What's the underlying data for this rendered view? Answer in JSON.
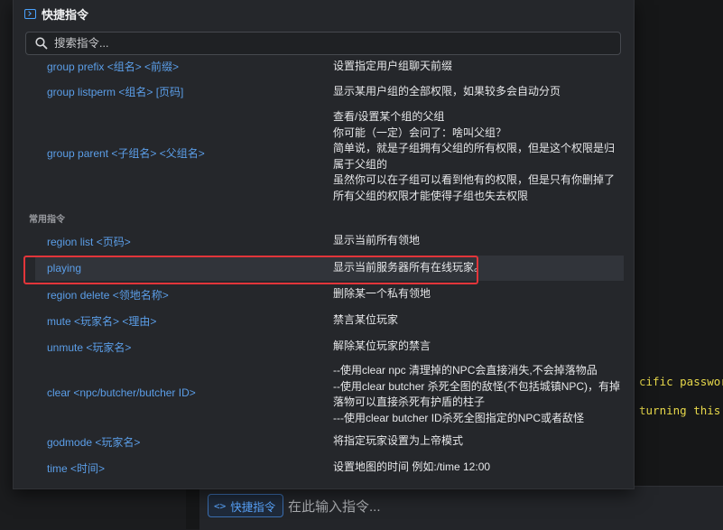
{
  "panel": {
    "title": "快捷指令",
    "search_placeholder": "搜索指令..."
  },
  "commands_top": [
    {
      "cmd": "group prefix <组名> <前缀>",
      "desc": [
        "设置指定用户组聊天前缀"
      ]
    },
    {
      "cmd": "group listperm <组名> [页码]",
      "desc": [
        "显示某用户组的全部权限，如果较多会自动分页"
      ]
    },
    {
      "cmd": "group parent <子组名> <父组名>",
      "desc": [
        "查看/设置某个组的父组",
        "你可能（一定）会问了：啥叫父组？",
        "简单说，就是子组拥有父组的所有权限，但是这个权限是归属于父组的",
        "虽然你可以在子组可以看到他有的权限，但是只有你删掉了所有父组的权限才能使得子组也失去权限"
      ]
    }
  ],
  "section_label": "常用指令",
  "commands_common": [
    {
      "cmd": "region list <页码>",
      "desc": [
        "显示当前所有领地"
      ]
    },
    {
      "cmd": "playing",
      "desc": [
        "显示当前服务器所有在线玩家。"
      ]
    },
    {
      "cmd": "region delete <领地名称>",
      "desc": [
        "删除某一个私有领地"
      ]
    },
    {
      "cmd": "mute <玩家名> <理由>",
      "desc": [
        "禁言某位玩家"
      ]
    },
    {
      "cmd": "unmute <玩家名>",
      "desc": [
        "解除某位玩家的禁言"
      ]
    },
    {
      "cmd": "clear <npc/butcher/butcher ID>",
      "desc": [
        "--使用clear npc 清理掉的NPC会直接消失,不会掉落物品",
        "--使用clear butcher 杀死全图的敌怪(不包括城镇NPC)，有掉落物可以直接杀死有护盾的柱子",
        "---使用clear butcher ID杀死全图指定的NPC或者敌怪"
      ]
    },
    {
      "cmd": "godmode <玩家名>",
      "desc": [
        "将指定玩家设置为上帝模式"
      ]
    },
    {
      "cmd": "time <时间>",
      "desc": [
        "设置地图的时间 例如:/time 12:00"
      ]
    }
  ],
  "input_bar": {
    "quick_button": "快捷指令",
    "placeholder": "在此输入指令..."
  },
  "terminal_fragments": [
    "cific password",
    "turning this"
  ],
  "colors": {
    "accent": "#5b9ee8",
    "highlight_border": "#e2353a",
    "terminal_text": "#e7d84a"
  }
}
